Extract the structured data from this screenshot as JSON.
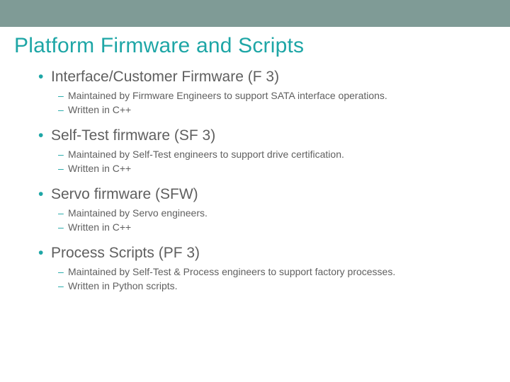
{
  "title": "Platform Firmware and Scripts",
  "sections": [
    {
      "heading": "Interface/Customer Firmware (F 3)",
      "subs": [
        "Maintained by Firmware Engineers to support SATA interface operations.",
        "Written in C++"
      ]
    },
    {
      "heading": "Self-Test firmware (SF 3)",
      "subs": [
        "Maintained by Self-Test engineers to support drive certification.",
        "Written in C++"
      ]
    },
    {
      "heading": "Servo firmware (SFW)",
      "subs": [
        "Maintained by Servo engineers.",
        "Written in C++"
      ]
    },
    {
      "heading": "Process Scripts (PF 3)",
      "subs": [
        "Maintained by Self-Test & Process engineers to support factory processes.",
        "Written in Python scripts."
      ]
    }
  ]
}
